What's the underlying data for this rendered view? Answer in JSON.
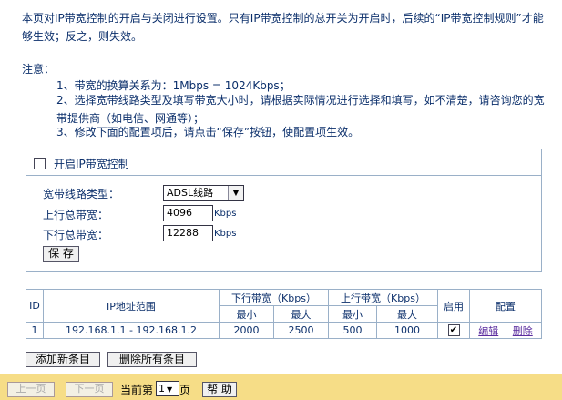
{
  "intro": "本页对IP带宽控制的开启与关闭进行设置。只有IP带宽控制的总开关为开启时，后续的“IP带宽控制规则”才能够生效；反之，则失效。",
  "notes": {
    "title": "注意：",
    "items": [
      "1、带宽的换算关系为：1Mbps = 1024Kbps；",
      "2、选择宽带线路类型及填写带宽大小时，请根据实际情况进行选择和填写，如不清楚，请咨询您的宽带提供商（如电信、网通等）；",
      "3、修改下面的配置项后，请点击“保存”按钮，使配置项生效。"
    ]
  },
  "settings": {
    "enable_label": "开启IP带宽控制",
    "enabled": false,
    "line_type_label": "宽带线路类型：",
    "line_type_value": "ADSL线路",
    "upload_label": "上行总带宽：",
    "upload_value": "4096",
    "download_label": "下行总带宽：",
    "download_value": "12288",
    "unit": "Kbps",
    "save_label": "保 存"
  },
  "table": {
    "headers": {
      "id": "ID",
      "ip_range": "IP地址范围",
      "down": "下行带宽（Kbps）",
      "up": "上行带宽（Kbps）",
      "enable": "启用",
      "config": "配置",
      "min": "最小",
      "max": "最大"
    },
    "rows": [
      {
        "id": "1",
        "ip_range": "192.168.1.1 - 192.168.1.2",
        "down_min": "2000",
        "down_max": "2500",
        "up_min": "500",
        "up_max": "1000",
        "enabled": true,
        "edit": "编辑",
        "delete": "删除"
      }
    ]
  },
  "actions": {
    "add": "添加新条目",
    "delete_all": "删除所有条目"
  },
  "footer": {
    "prev": "上一页",
    "next": "下一页",
    "current_prefix": "当前第",
    "page": "1",
    "page_suffix": "页",
    "help": "帮 助"
  },
  "colors": {
    "text": "#0b2f6b",
    "footer_bg": "#f6dd87",
    "border": "#9ab0c8"
  }
}
